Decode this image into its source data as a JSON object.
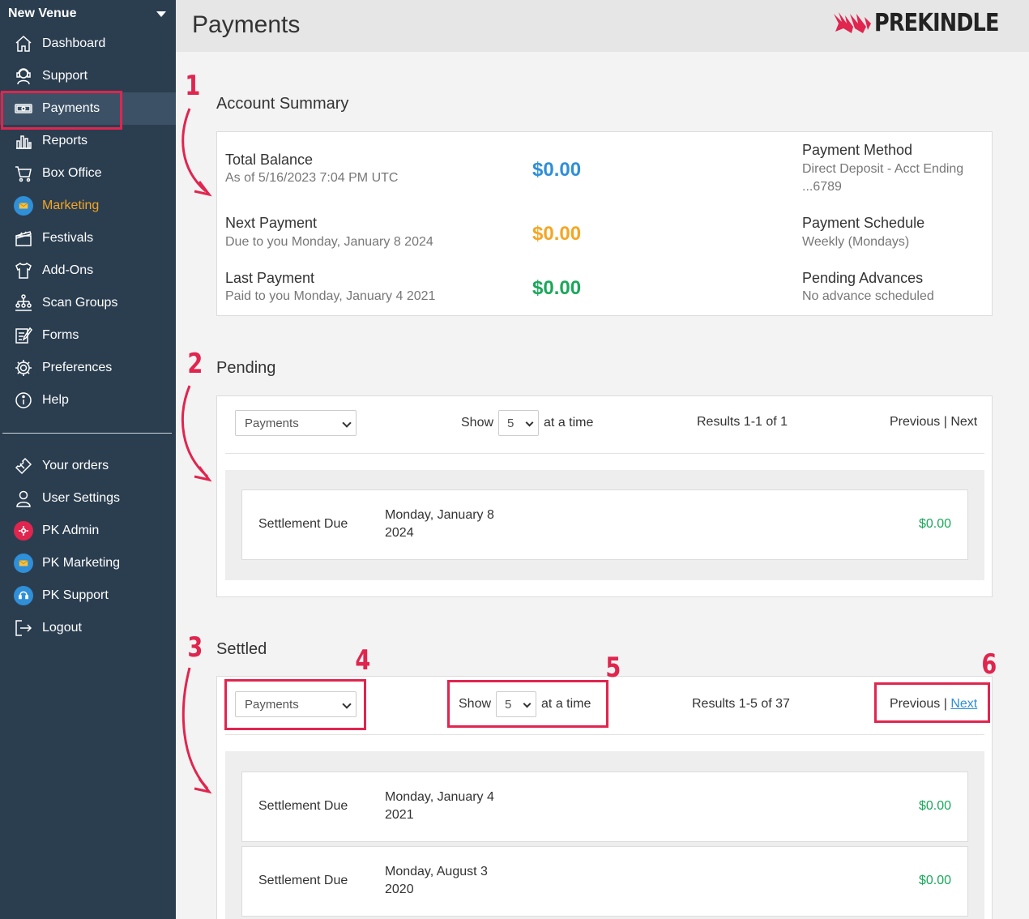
{
  "sidebar": {
    "venue": "New Venue",
    "items": [
      {
        "label": "Dashboard",
        "icon": "home-icon"
      },
      {
        "label": "Support",
        "icon": "headset-icon"
      },
      {
        "label": "Payments",
        "icon": "money-icon"
      },
      {
        "label": "Reports",
        "icon": "bar-chart-icon"
      },
      {
        "label": "Box Office",
        "icon": "cart-icon"
      },
      {
        "label": "Marketing",
        "icon": "marketing-icon"
      },
      {
        "label": "Festivals",
        "icon": "clapper-icon"
      },
      {
        "label": "Add-Ons",
        "icon": "shirt-icon"
      },
      {
        "label": "Scan Groups",
        "icon": "org-chart-icon"
      },
      {
        "label": "Forms",
        "icon": "form-icon"
      },
      {
        "label": "Preferences",
        "icon": "gear-icon"
      },
      {
        "label": "Help",
        "icon": "info-icon"
      }
    ],
    "bottom_items": [
      {
        "label": "Your orders",
        "icon": "ticket-icon"
      },
      {
        "label": "User Settings",
        "icon": "user-icon"
      },
      {
        "label": "PK Admin",
        "icon": "admin-gear-icon"
      },
      {
        "label": "PK Marketing",
        "icon": "marketing-icon"
      },
      {
        "label": "PK Support",
        "icon": "support-icon"
      },
      {
        "label": "Logout",
        "icon": "logout-icon"
      }
    ]
  },
  "header": {
    "title": "Payments",
    "logo_text": "PREKINDLE"
  },
  "summary": {
    "title": "Account Summary",
    "total_label": "Total Balance",
    "total_sub": "As of 5/16/2023 7:04 PM UTC",
    "total_amount": "$0.00",
    "next_label": "Next Payment",
    "next_sub": "Due to you Monday, January 8 2024",
    "next_amount": "$0.00",
    "last_label": "Last Payment",
    "last_sub": "Paid to you Monday, January 4 2021",
    "last_amount": "$0.00",
    "method_label": "Payment Method",
    "method_sub1": "Direct Deposit - Acct Ending",
    "method_sub2": "...6789",
    "schedule_label": "Payment Schedule",
    "schedule_sub": "Weekly (Mondays)",
    "advances_label": "Pending Advances",
    "advances_sub": "No advance scheduled",
    "colors": {
      "total": "#2f8fd8",
      "next": "#f5a623",
      "last": "#1aa85a"
    }
  },
  "pending": {
    "title": "Pending",
    "filter": "Payments",
    "show_label": "Show",
    "show_value": "5",
    "at_a_time": "at a time",
    "results": "Results 1-1 of 1",
    "previous": "Previous",
    "separator": "|",
    "next": "Next",
    "rows": [
      {
        "type": "Settlement Due",
        "date1": "Monday, January 8",
        "date2": "2024",
        "amount": "$0.00"
      }
    ]
  },
  "settled": {
    "title": "Settled",
    "filter": "Payments",
    "show_label": "Show",
    "show_value": "5",
    "at_a_time": "at a time",
    "results": "Results 1-5 of 37",
    "previous": "Previous",
    "separator": "|",
    "next": "Next",
    "rows": [
      {
        "type": "Settlement Due",
        "date1": "Monday, January 4",
        "date2": "2021",
        "amount": "$0.00"
      },
      {
        "type": "Settlement Due",
        "date1": "Monday, August 3",
        "date2": "2020",
        "amount": "$0.00"
      }
    ]
  },
  "annotations": [
    "1",
    "2",
    "3",
    "4",
    "5",
    "6"
  ]
}
